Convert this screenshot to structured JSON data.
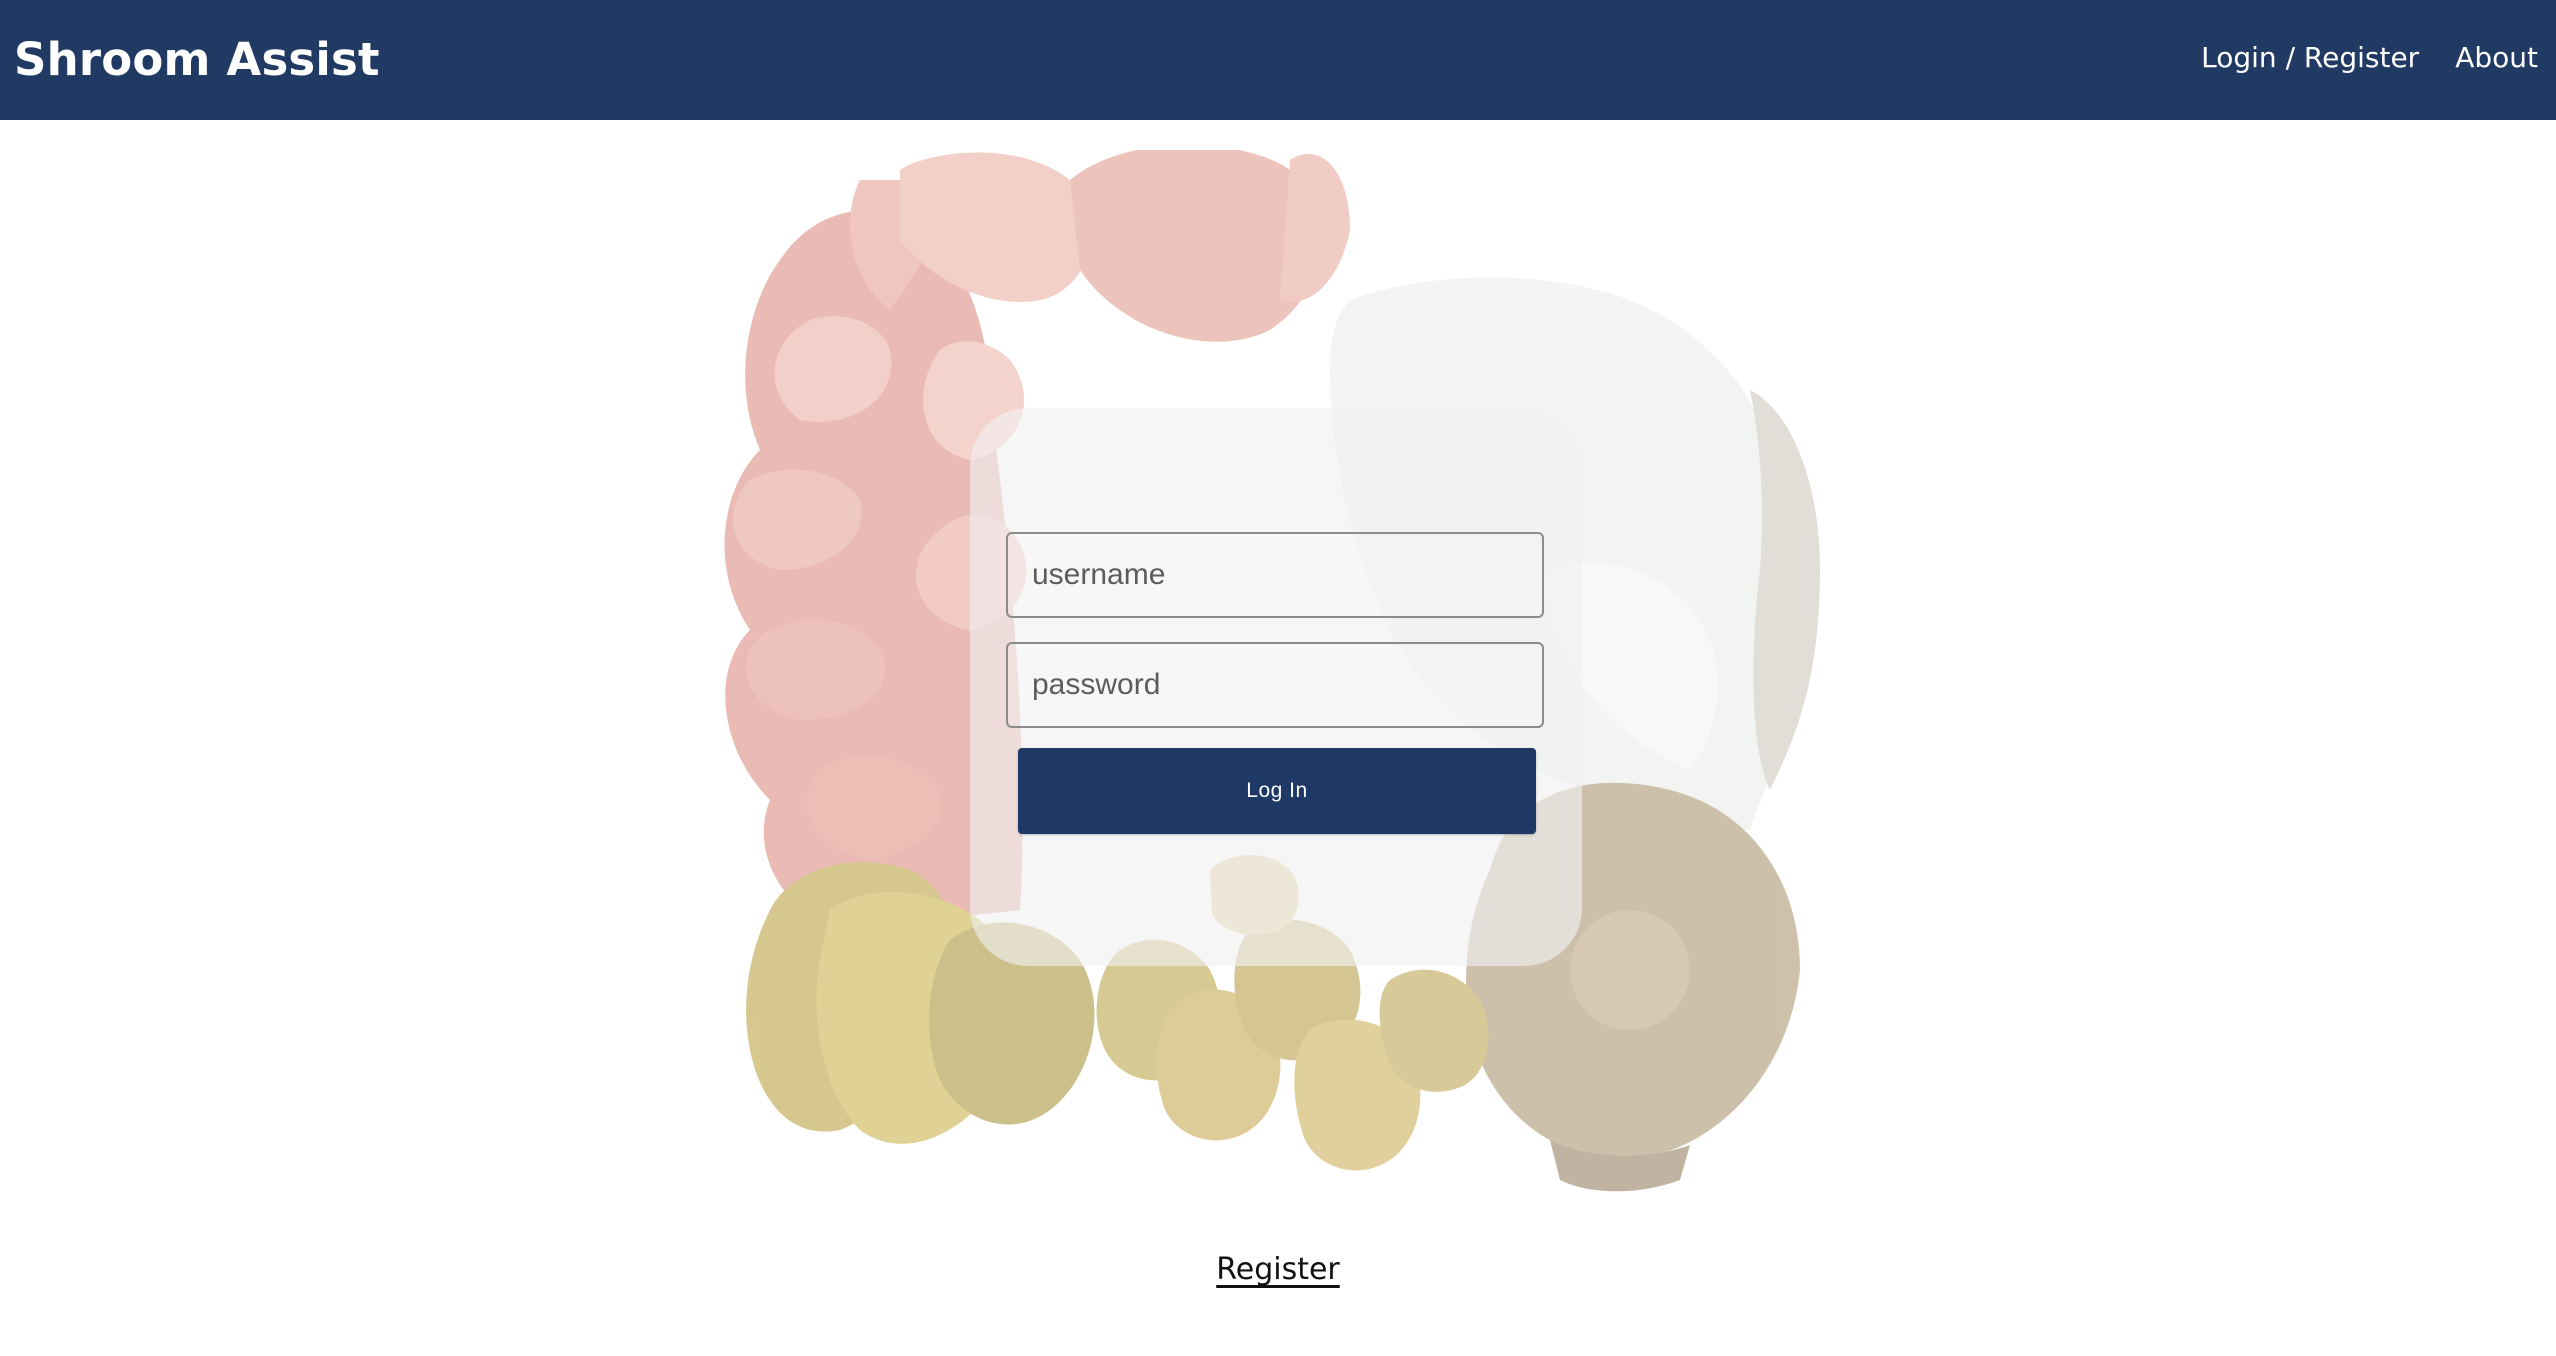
{
  "header": {
    "brand": "Shroom Assist",
    "nav": {
      "login_register": "Login / Register",
      "about": "About"
    }
  },
  "login": {
    "username_placeholder": "username",
    "password_placeholder": "password",
    "submit_label": "Log In"
  },
  "footer_link": {
    "register": "Register"
  },
  "colors": {
    "nav_bg": "#203a64",
    "button_bg": "#1e3966"
  },
  "icons": {
    "hero_image": "mushroom-cluster-image"
  }
}
